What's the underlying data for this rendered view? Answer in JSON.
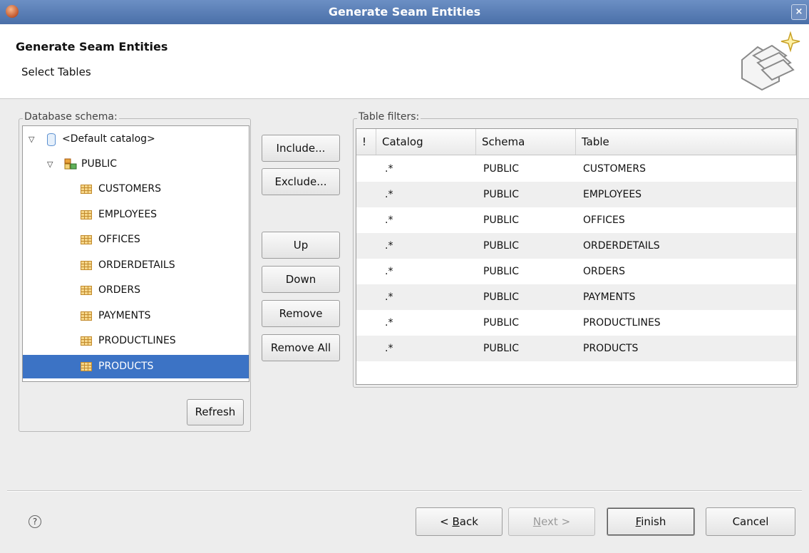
{
  "window": {
    "title": "Generate Seam Entities",
    "close_label": "×"
  },
  "header": {
    "title": "Generate Seam Entities",
    "subtitle": "Select Tables",
    "icon": "wizard-banner-icon"
  },
  "schema_panel": {
    "label": "Database schema:",
    "catalog": "<Default catalog>",
    "schema": "PUBLIC",
    "tables": [
      "CUSTOMERS",
      "EMPLOYEES",
      "OFFICES",
      "ORDERDETAILS",
      "ORDERS",
      "PAYMENTS",
      "PRODUCTLINES",
      "PRODUCTS"
    ],
    "selected_table": "PRODUCTS",
    "refresh_label": "Refresh"
  },
  "actions": {
    "include": "Include...",
    "exclude": "Exclude...",
    "up": "Up",
    "down": "Down",
    "remove": "Remove",
    "remove_all": "Remove All"
  },
  "filters": {
    "label": "Table filters:",
    "columns": [
      "!",
      "Catalog",
      "Schema",
      "Table"
    ],
    "rows": [
      {
        "catalog": ".*",
        "schema": "PUBLIC",
        "table": "CUSTOMERS"
      },
      {
        "catalog": ".*",
        "schema": "PUBLIC",
        "table": "EMPLOYEES"
      },
      {
        "catalog": ".*",
        "schema": "PUBLIC",
        "table": "OFFICES"
      },
      {
        "catalog": ".*",
        "schema": "PUBLIC",
        "table": "ORDERDETAILS"
      },
      {
        "catalog": ".*",
        "schema": "PUBLIC",
        "table": "ORDERS"
      },
      {
        "catalog": ".*",
        "schema": "PUBLIC",
        "table": "PAYMENTS"
      },
      {
        "catalog": ".*",
        "schema": "PUBLIC",
        "table": "PRODUCTLINES"
      },
      {
        "catalog": ".*",
        "schema": "PUBLIC",
        "table": "PRODUCTS"
      }
    ]
  },
  "footer": {
    "help_icon": "help-icon",
    "back_prefix": "< ",
    "back_mnemonic": "B",
    "back_rest": "ack",
    "next_mnemonic": "N",
    "next_rest": "ext >",
    "finish_mnemonic": "F",
    "finish_rest": "inish",
    "cancel": "Cancel"
  },
  "colors": {
    "selection": "#3c73c5",
    "titlebar": "#5a7db6"
  }
}
